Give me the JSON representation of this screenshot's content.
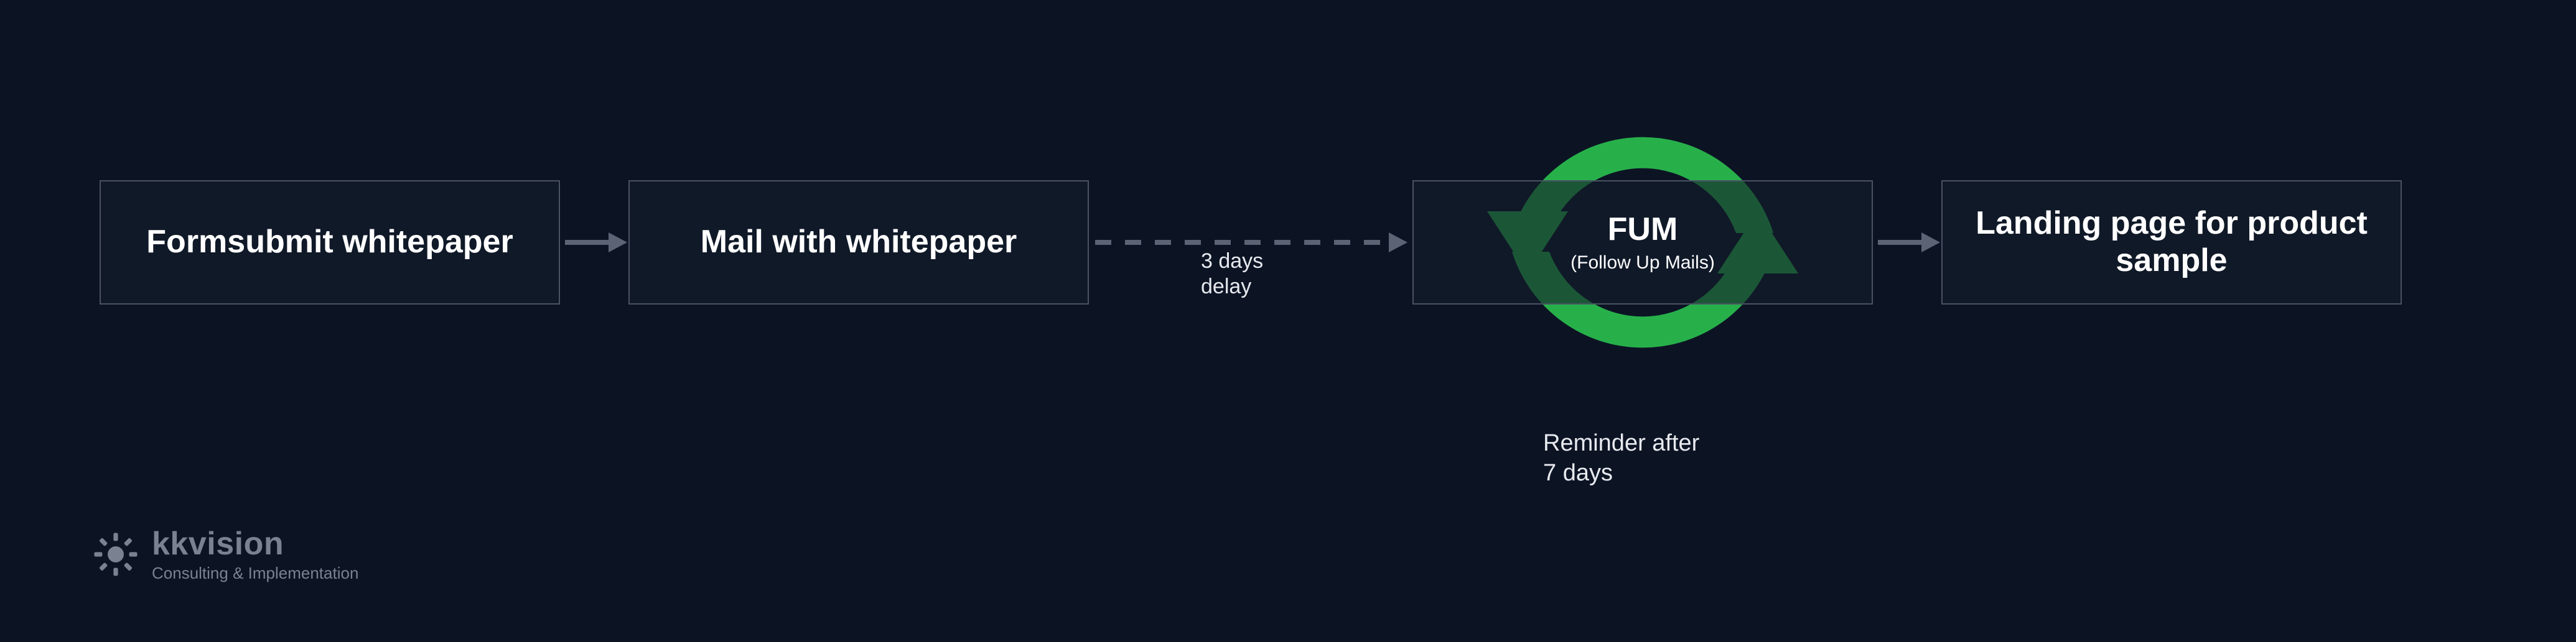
{
  "colors": {
    "background": "#0c1424",
    "node_border": "#4a5263",
    "arrow": "#5b6374",
    "cycle": "#27b04a",
    "text": "#ffffff",
    "muted": "#7a8191"
  },
  "flow": {
    "nodes": [
      {
        "title": "Formsubmit whitepaper",
        "sub": ""
      },
      {
        "title": "Mail with whitepaper",
        "sub": ""
      },
      {
        "title": "FUM",
        "sub": "(Follow Up Mails)"
      },
      {
        "title": "Landing page for product sample",
        "sub": ""
      }
    ],
    "delay_label_line1": "3 days",
    "delay_label_line2": "delay",
    "reminder_label_line1": "Reminder after",
    "reminder_label_line2": "7 days"
  },
  "brand": {
    "name": "kkvision",
    "tagline": "Consulting & Implementation"
  }
}
